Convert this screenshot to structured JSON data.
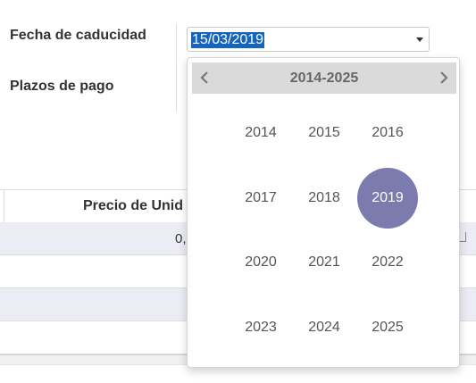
{
  "form": {
    "expiry_label": "Fecha de caducidad",
    "payment_terms_label": "Plazos de pago",
    "expiry_value": "15/03/2019"
  },
  "table": {
    "header_price": "Precio de Unid",
    "row1_value": "0,"
  },
  "datepicker": {
    "range_title": "2014-2025",
    "selected_year": "2019",
    "years": [
      "2014",
      "2015",
      "2016",
      "2017",
      "2018",
      "2019",
      "2020",
      "2021",
      "2022",
      "2023",
      "2024",
      "2025"
    ],
    "prev_icon": "chevron-left-icon",
    "next_icon": "chevron-right-icon",
    "selected_color": "#7c7bad"
  },
  "colors": {
    "selection": "#1565c0",
    "row_alt": "#ececf4"
  }
}
